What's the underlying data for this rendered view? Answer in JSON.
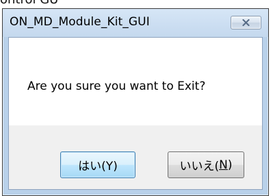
{
  "background": {
    "partial_text": "ontrol GU"
  },
  "dialog": {
    "title": "ON_MD_Module_Kit_GUI",
    "close_icon": "close-x-icon",
    "message": "Are you sure you want to Exit?",
    "buttons": {
      "yes_label": "はい(Y)",
      "no_label_prefix": "いいえ(",
      "no_label_mnemonic": "N",
      "no_label_suffix": ")"
    }
  },
  "colors": {
    "frame": "#b9d1ea",
    "default_button_border": "#3c7fb1",
    "button_area": "#f0f0f0"
  }
}
